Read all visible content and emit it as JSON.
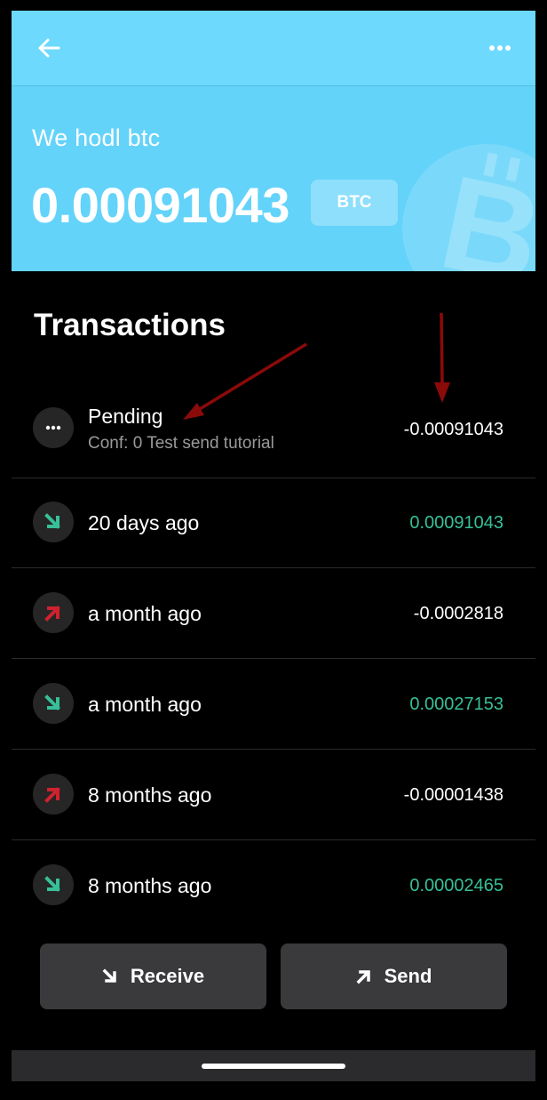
{
  "wallet": {
    "name": "We hodl btc",
    "balance": "0.00091043",
    "unit": "BTC"
  },
  "icons": {
    "back": "back-arrow-icon",
    "more": "more-dots-icon",
    "watermark": "bitcoin-logo-icon",
    "pending": "pending-dots-icon",
    "incoming": "incoming-arrow-icon",
    "outgoing": "outgoing-arrow-icon"
  },
  "colors": {
    "header": "#63d3fa",
    "incoming": "#37c098",
    "outgoing_icon": "#d0212f",
    "annotation": "#8b0a0a"
  },
  "transactions": {
    "title": "Transactions",
    "items": [
      {
        "status": "pending",
        "label": "Pending",
        "sub": "Conf: 0 Test send tutorial",
        "amount": "-0.00091043"
      },
      {
        "status": "incoming",
        "label": "20 days ago",
        "amount": "0.00091043"
      },
      {
        "status": "outgoing",
        "label": "a month ago",
        "amount": "-0.0002818"
      },
      {
        "status": "incoming",
        "label": "a month ago",
        "amount": "0.00027153"
      },
      {
        "status": "outgoing",
        "label": "8 months ago",
        "amount": "-0.00001438"
      },
      {
        "status": "incoming",
        "label": "8 months ago",
        "amount": "0.00002465"
      }
    ]
  },
  "actions": {
    "receive_label": "Receive",
    "send_label": "Send"
  }
}
